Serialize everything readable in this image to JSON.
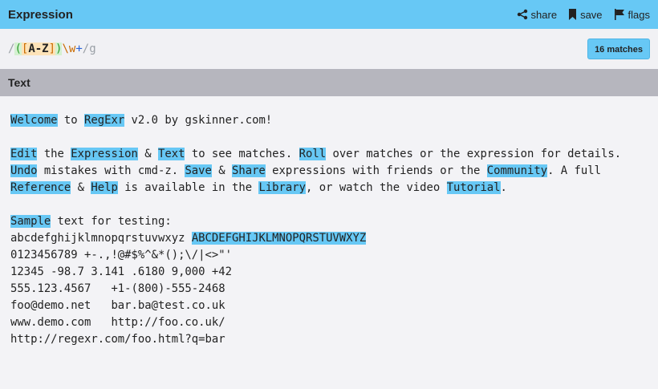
{
  "header": {
    "title": "Expression",
    "actions": [
      {
        "label": "share",
        "icon": "share-icon"
      },
      {
        "label": "save",
        "icon": "bookmark-icon"
      },
      {
        "label": "flags",
        "icon": "flag-icon"
      }
    ]
  },
  "expression": {
    "open_slash": "/",
    "group_open": "(",
    "set_open": "[",
    "range": "A-Z",
    "set_close": "]",
    "group_close": ")",
    "word_escape": "\\w",
    "quantifier": "+",
    "close_slash": "/",
    "flags": "g",
    "matches_label": "16 matches"
  },
  "text_panel": {
    "title": "Text",
    "lines": [
      [
        [
          "Welcome",
          true
        ],
        [
          " to ",
          false
        ],
        [
          "RegExr",
          true
        ],
        [
          " v2.0 by gskinner.com!",
          false
        ]
      ],
      [],
      [
        [
          "Edit",
          true
        ],
        [
          " the ",
          false
        ],
        [
          "Expression",
          true
        ],
        [
          " & ",
          false
        ],
        [
          "Text",
          true
        ],
        [
          " to see matches. ",
          false
        ],
        [
          "Roll",
          true
        ],
        [
          " over matches or the expression for details.",
          false
        ]
      ],
      [
        [
          "Undo",
          true
        ],
        [
          " mistakes with cmd-z. ",
          false
        ],
        [
          "Save",
          true
        ],
        [
          " & ",
          false
        ],
        [
          "Share",
          true
        ],
        [
          " expressions with friends or the ",
          false
        ],
        [
          "Community",
          true
        ],
        [
          ". A full",
          false
        ]
      ],
      [
        [
          "Reference",
          true
        ],
        [
          " & ",
          false
        ],
        [
          "Help",
          true
        ],
        [
          " is available in the ",
          false
        ],
        [
          "Library",
          true
        ],
        [
          ", or watch the video ",
          false
        ],
        [
          "Tutorial",
          true
        ],
        [
          ".",
          false
        ]
      ],
      [],
      [
        [
          "Sample",
          true
        ],
        [
          " text for testing:",
          false
        ]
      ],
      [
        [
          "abcdefghijklmnopqrstuvwxyz ",
          false
        ],
        [
          "ABCDEFGHIJKLMNOPQRSTUVWXYZ",
          true
        ]
      ],
      [
        [
          "0123456789 +-.,!@#$%^&*();\\/|<>\"'",
          false
        ]
      ],
      [
        [
          "12345 -98.7 3.141 .6180 9,000 +42",
          false
        ]
      ],
      [
        [
          "555.123.4567   +1-(800)-555-2468",
          false
        ]
      ],
      [
        [
          "foo@demo.net   bar.ba@test.co.uk",
          false
        ]
      ],
      [
        [
          "www.demo.com   http://foo.co.uk/",
          false
        ]
      ],
      [
        [
          "http://regexr.com/foo.html?q=bar",
          false
        ]
      ]
    ]
  },
  "colors": {
    "accent": "#67c8f5",
    "text_bar": "#b6b6be",
    "background": "#f1f1f4"
  }
}
